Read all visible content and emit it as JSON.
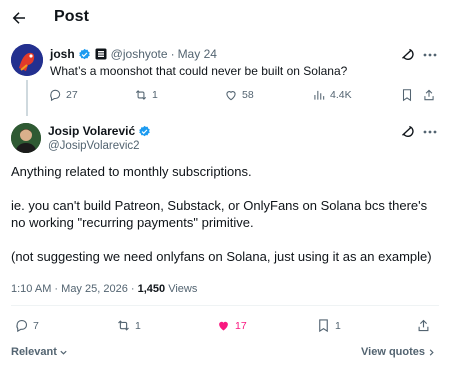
{
  "header": {
    "title": "Post",
    "back_icon": "arrow-left-icon"
  },
  "parent_tweet": {
    "name": "josh",
    "handle": "@joshyote",
    "separator": "·",
    "date": "May 24",
    "text": "What’s a moonshot that could never be built on Solana?",
    "replies": "27",
    "reposts": "1",
    "likes": "58",
    "views": "4.4K"
  },
  "main_tweet": {
    "name": "Josip Volarević",
    "handle": "@JosipVolarevic2",
    "body": [
      "Anything related to monthly subscriptions.",
      "ie. you can't build Patreon, Substack, or OnlyFans on Solana bcs there's no working \"recurring payments\" primitive.",
      "(not suggesting we need onlyfans on Solana, just using it as an example)"
    ],
    "time": "1:10 AM",
    "date": "May 25, 2026",
    "separator": "·",
    "views_count": "1,450",
    "views_label": "Views",
    "replies": "7",
    "reposts": "1",
    "likes": "17",
    "bookmarks": "1"
  },
  "footer": {
    "sort_label": "Relevant",
    "quotes_label": "View quotes"
  },
  "colors": {
    "verified": "#1d9bf0",
    "like": "#f91880",
    "muted": "#536471",
    "text": "#0f1419"
  }
}
